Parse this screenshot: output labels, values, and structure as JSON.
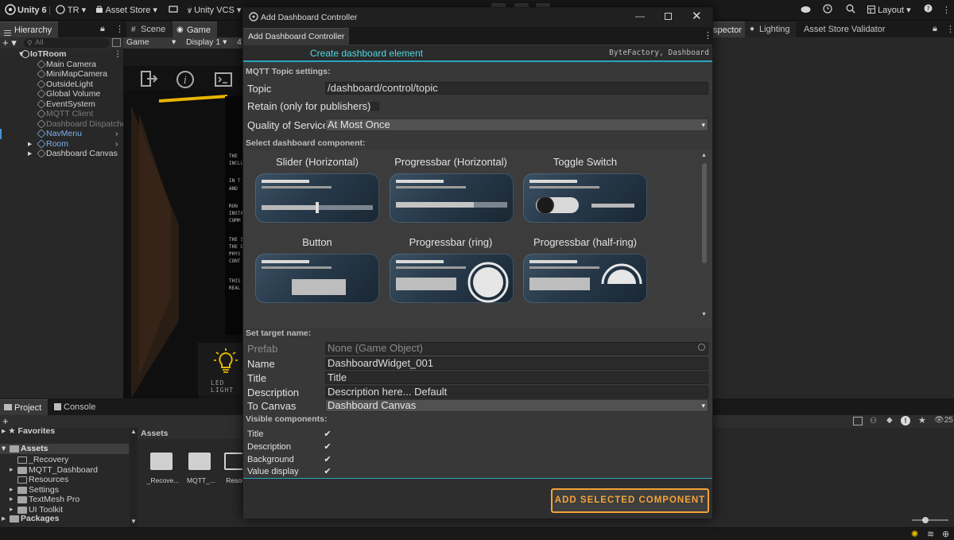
{
  "topbar": {
    "unity": "Unity 6",
    "account": "TR",
    "asset_store": "Asset Store",
    "vcs": "Unity VCS",
    "layout": "Layout"
  },
  "hierarchy": {
    "tab": "Hierarchy",
    "search_placeholder": "All",
    "items": [
      {
        "label": "IoTRoom",
        "state": "scene"
      },
      {
        "label": "Main Camera",
        "state": "normal"
      },
      {
        "label": "MiniMapCamera",
        "state": "normal"
      },
      {
        "label": "OutsideLight",
        "state": "normal"
      },
      {
        "label": "Global Volume",
        "state": "normal"
      },
      {
        "label": "EventSystem",
        "state": "normal"
      },
      {
        "label": "MQTT Client",
        "state": "disabled"
      },
      {
        "label": "Dashboard Dispatche",
        "state": "disabled"
      },
      {
        "label": "NavMenu",
        "state": "prefab"
      },
      {
        "label": "Room",
        "state": "prefab"
      },
      {
        "label": "Dashboard Canvas",
        "state": "normal"
      }
    ]
  },
  "scene_tabs": {
    "scene": "Scene",
    "game": "Game",
    "game_dropdown": "Game",
    "display": "Display 1",
    "aspect": "4"
  },
  "game_view": {
    "led_label": "LED LIGHT"
  },
  "right_tabs": {
    "inspector": "spector",
    "lighting": "Lighting",
    "validator": "Asset Store Validator"
  },
  "bottom": {
    "project_tab": "Project",
    "console_tab": "Console",
    "favorites": "Favorites",
    "assets": "Assets",
    "folders": [
      "_Recovery",
      "MQTT_Dashboard",
      "Resources",
      "Settings",
      "TextMesh Pro",
      "UI Toolkit"
    ],
    "packages": "Packages",
    "assets_header": "Assets",
    "grid_items": [
      "_Recove...",
      "MQTT_...",
      "Resour"
    ],
    "count": "25"
  },
  "dialog": {
    "title": "Add Dashboard Controller",
    "tab": "Add Dashboard Controller",
    "header_title": "Create dashboard element",
    "header_right": "ByteFactory, Dashboard",
    "mqtt_section": "MQTT Topic settings:",
    "topic_label": "Topic",
    "topic_value": "/dashboard/control/topic",
    "retain_label": "Retain (only for publishers)",
    "qos_label": "Quality of Service",
    "qos_value": "At Most Once",
    "select_section": "Select dashboard component:",
    "components": [
      "Slider (Horizontal)",
      "Progressbar (Horizontal)",
      "Toggle Switch",
      "Button",
      "Progressbar (ring)",
      "Progressbar (half-ring)"
    ],
    "target_section": "Set target name:",
    "prefab_label": "Prefab",
    "prefab_value": "None (Game Object)",
    "name_label": "Name",
    "name_value": "DashboardWidget_001",
    "title_label": "Title",
    "title_value": "Title",
    "description_label": "Description",
    "description_value": "Description here... Default",
    "canvas_label": "To Canvas",
    "canvas_value": "Dashboard Canvas",
    "visible_section": "Visible components:",
    "visible": [
      {
        "label": "Title",
        "checked": true
      },
      {
        "label": "Description",
        "checked": true
      },
      {
        "label": "Background",
        "checked": true
      },
      {
        "label": "Value display",
        "checked": true
      }
    ],
    "add_button": "ADD SELECTED COMPONENT",
    "accent": "#3bb8d6",
    "button_color": "#f2a33a"
  }
}
